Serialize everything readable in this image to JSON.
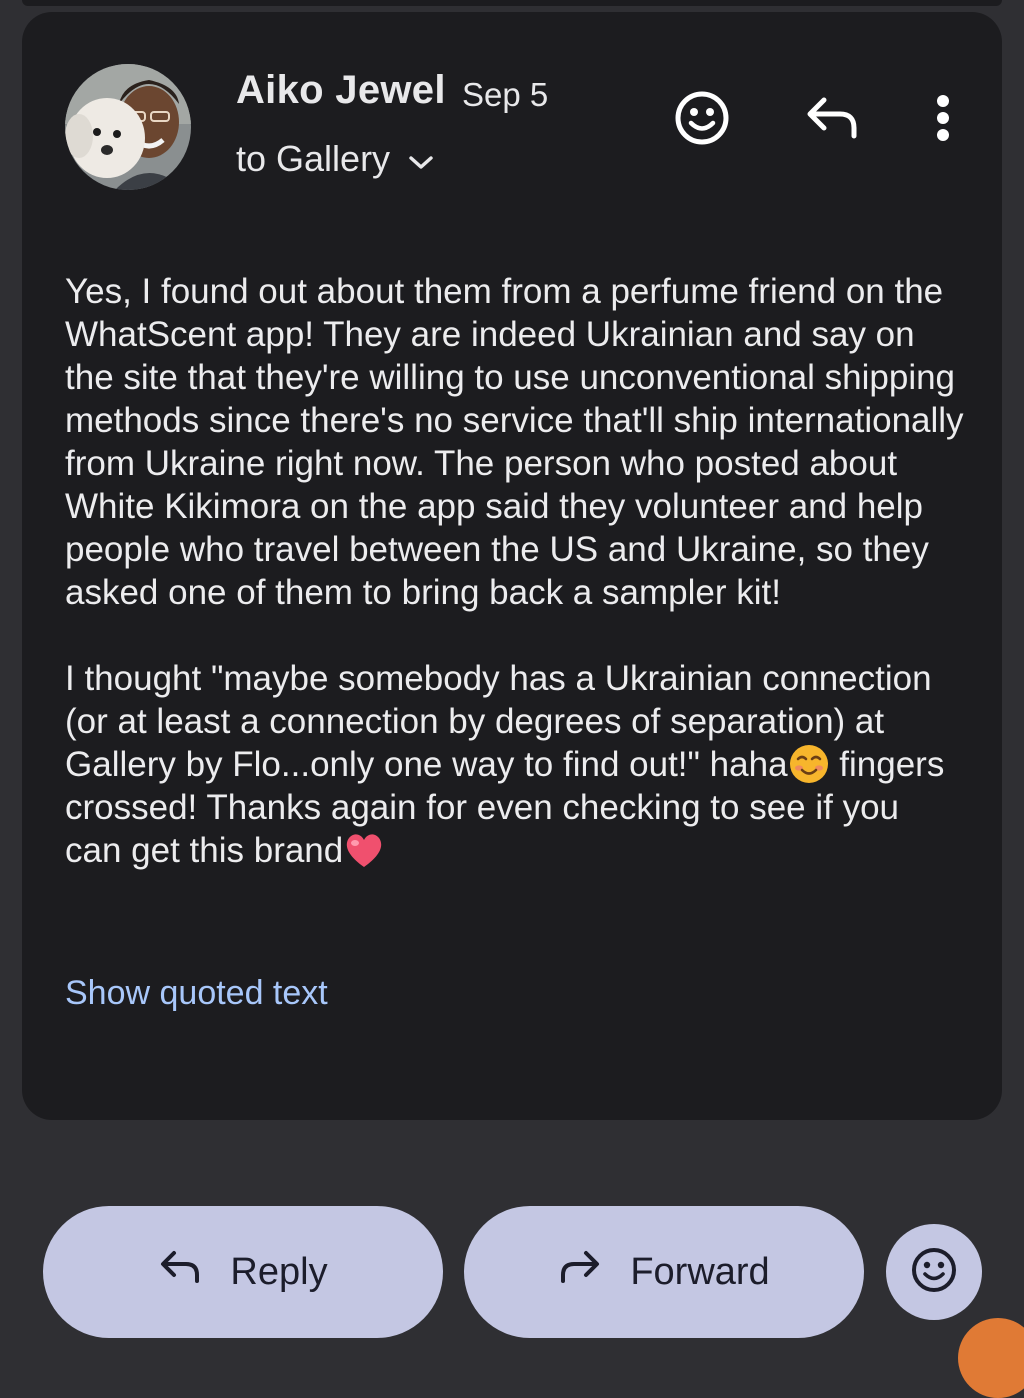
{
  "message": {
    "sender_name": "Aiko Jewel",
    "date": "Sep 5",
    "recipient_line": "to Gallery",
    "body_paragraph_1": "Yes, I found out about them from a perfume friend on the WhatScent app! They are indeed Ukrainian and say on the site that they're willing to use unconventional shipping methods since there's no service that'll ship internationally from Ukraine right now. The person who posted about White Kikimora on the app said they volunteer and help people who travel between the US and Ukraine, so they asked one of them to bring back a sampler kit!",
    "body_paragraph_2_before_emoji": "I thought \"maybe somebody has a Ukrainian connection (or at least a connection by degrees of separation) at Gallery by Flo...only one way to find out!\" haha",
    "body_paragraph_2_after_emoji": " fingers crossed! Thanks again for even checking to see if you can get this brand",
    "show_quoted_label": "Show quoted text"
  },
  "header_icons": [
    "add-reaction-icon",
    "reply-icon",
    "more-vert-icon"
  ],
  "inline_emojis": [
    "smiling-face-emoji",
    "heart-emoji"
  ],
  "actions": {
    "reply_label": "Reply",
    "forward_label": "Forward",
    "react_icon": "add-reaction-icon"
  },
  "colors": {
    "background": "#2f2f33",
    "card": "#1c1c1f",
    "text": "#e8e8ea",
    "link": "#a8c7fa",
    "button_fill": "#c4c7e3",
    "button_text": "#1c1d2b",
    "fab_accent": "#e07a35"
  }
}
